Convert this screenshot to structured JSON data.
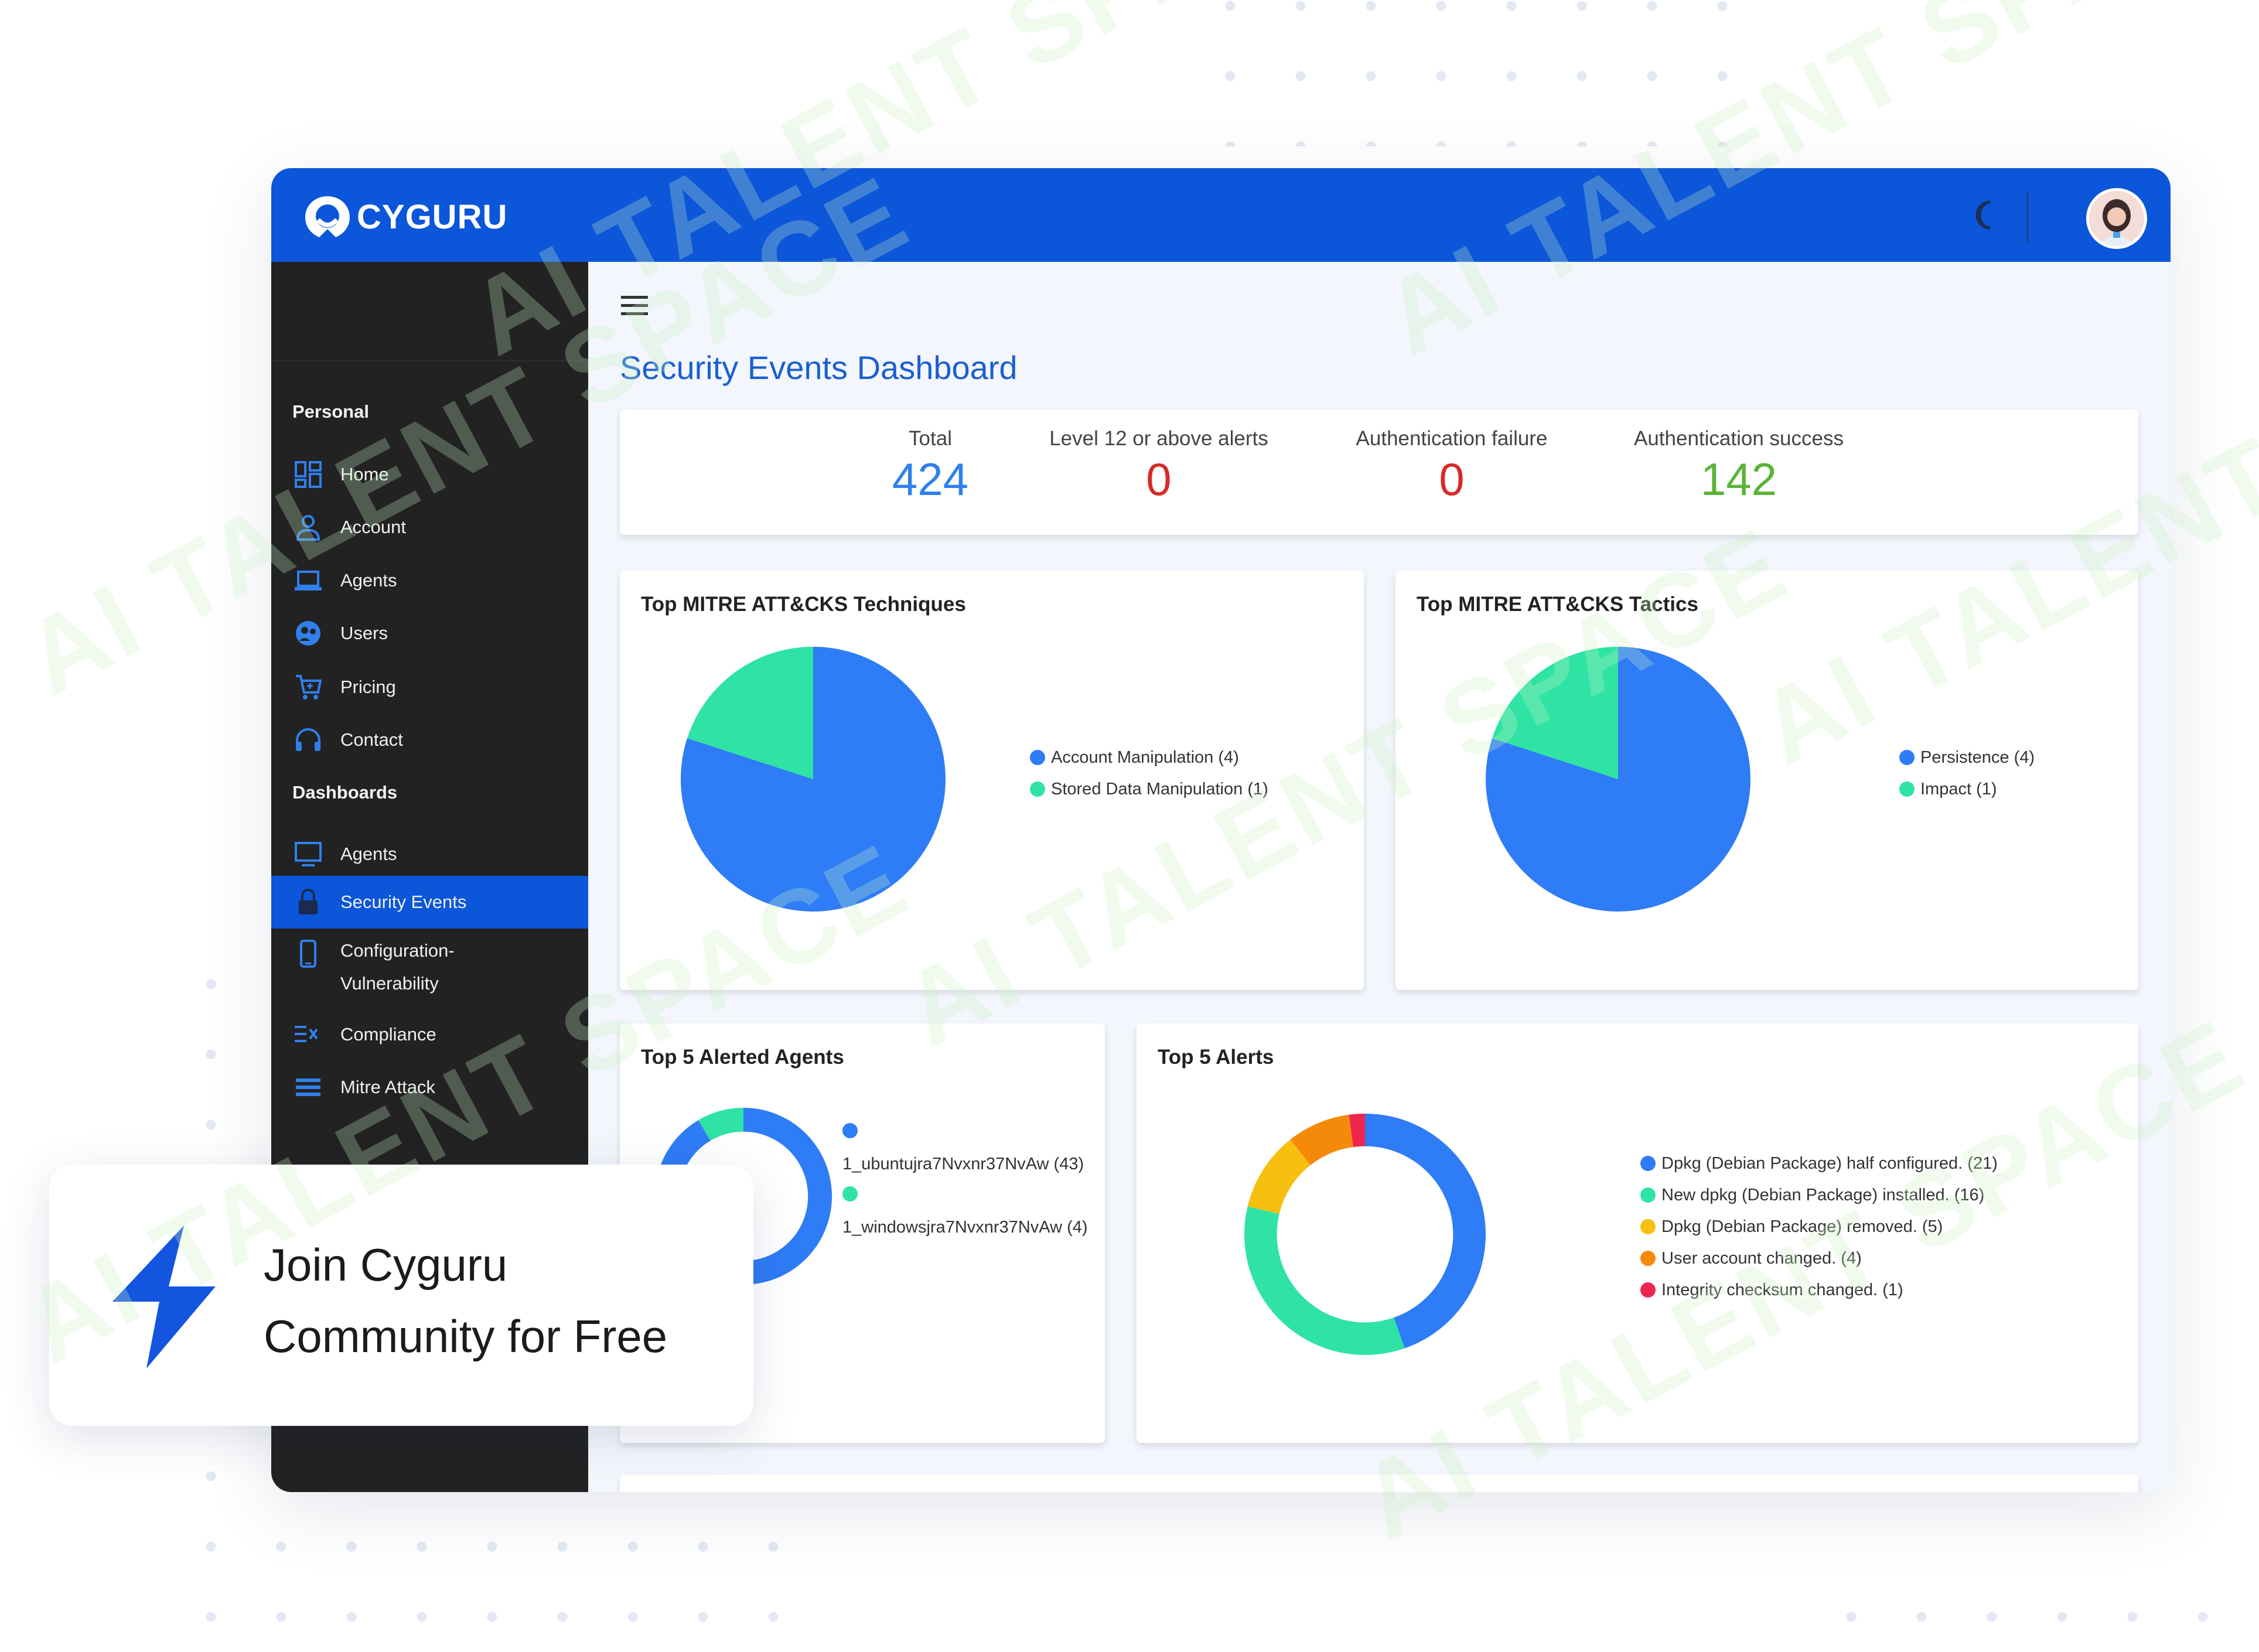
{
  "app": {
    "brand": "CYGURU"
  },
  "colors": {
    "brand_blue": "#0b56d9",
    "sidebar_bg": "#222222",
    "title_blue": "#1a5fd1",
    "total_blue": "#2f80ed",
    "alert_red": "#d62a2a",
    "success_green": "#5cb33a"
  },
  "sidebar": {
    "personal_title": "Personal",
    "personal": [
      {
        "label": "Home",
        "icon": "grid-icon"
      },
      {
        "label": "Account",
        "icon": "user-icon"
      },
      {
        "label": "Agents",
        "icon": "laptop-icon"
      },
      {
        "label": "Users",
        "icon": "globe-users-icon"
      },
      {
        "label": "Pricing",
        "icon": "cart-icon"
      },
      {
        "label": "Contact",
        "icon": "headset-icon"
      }
    ],
    "dashboards_title": "Dashboards",
    "dashboards": [
      {
        "label": "Agents",
        "icon": "monitor-icon"
      },
      {
        "label": "Security Events",
        "icon": "lock-icon",
        "active": true
      },
      {
        "label": "Configuration-\nVulnerability",
        "icon": "mobile-icon"
      },
      {
        "label": "Compliance",
        "icon": "checklist-icon"
      },
      {
        "label": "Mitre Attack",
        "icon": "list-icon"
      }
    ]
  },
  "main": {
    "title": "Security Events Dashboard",
    "stats": [
      {
        "label": "Total",
        "value": "424"
      },
      {
        "label": "Level 12 or above alerts",
        "value": "0"
      },
      {
        "label": "Authentication failure",
        "value": "0"
      },
      {
        "label": "Authentication success",
        "value": "142"
      }
    ]
  },
  "charts": {
    "techniques": {
      "title": "Top MITRE ATT&CKS Techniques",
      "legend": [
        "Account Manipulation (4)",
        "Stored Data Manipulation (1)"
      ]
    },
    "tactics": {
      "title": "Top MITRE ATT&CKS Tactics",
      "legend": [
        "Persistence (4)",
        "Impact (1)"
      ]
    },
    "agents": {
      "title": "Top 5 Alerted Agents",
      "legend": [
        "1_ubuntujra7Nvxnr37NvAw (43)",
        "1_windowsjra7Nvxnr37NvAw (4)"
      ]
    },
    "alerts": {
      "title": "Top 5 Alerts",
      "legend": [
        "Dpkg (Debian Package) half configured. (21)",
        "New dpkg (Debian Package) installed. (16)",
        "Dpkg (Debian Package) removed. (5)",
        "User account changed. (4)",
        "Integrity checksum changed. (1)"
      ]
    }
  },
  "chart_data": [
    {
      "type": "pie",
      "title": "Top MITRE ATT&CKS Techniques",
      "categories": [
        "Account Manipulation",
        "Stored Data Manipulation"
      ],
      "values": [
        4,
        1
      ],
      "colors": [
        "#2e7cf6",
        "#2fe3a4"
      ]
    },
    {
      "type": "pie",
      "title": "Top MITRE ATT&CKS Tactics",
      "categories": [
        "Persistence",
        "Impact"
      ],
      "values": [
        4,
        1
      ],
      "colors": [
        "#2e7cf6",
        "#2fe3a4"
      ]
    },
    {
      "type": "pie",
      "variant": "donut",
      "title": "Top 5 Alerted Agents",
      "categories": [
        "1_ubuntujra7Nvxnr37NvAw",
        "1_windowsjra7Nvxnr37NvAw"
      ],
      "values": [
        43,
        4
      ],
      "colors": [
        "#2e7cf6",
        "#2fe3a4"
      ]
    },
    {
      "type": "pie",
      "variant": "donut",
      "title": "Top 5 Alerts",
      "categories": [
        "Dpkg (Debian Package) half configured.",
        "New dpkg (Debian Package) installed.",
        "Dpkg (Debian Package) removed.",
        "User account changed.",
        "Integrity checksum changed."
      ],
      "values": [
        21,
        16,
        5,
        4,
        1
      ],
      "colors": [
        "#2e7cf6",
        "#2fe3a4",
        "#f7c010",
        "#f58a0a",
        "#f0254d"
      ]
    }
  ],
  "promo": {
    "line1": "Join Cyguru",
    "line2": "Community for Free"
  },
  "watermark": "AI TALENT SPACE"
}
